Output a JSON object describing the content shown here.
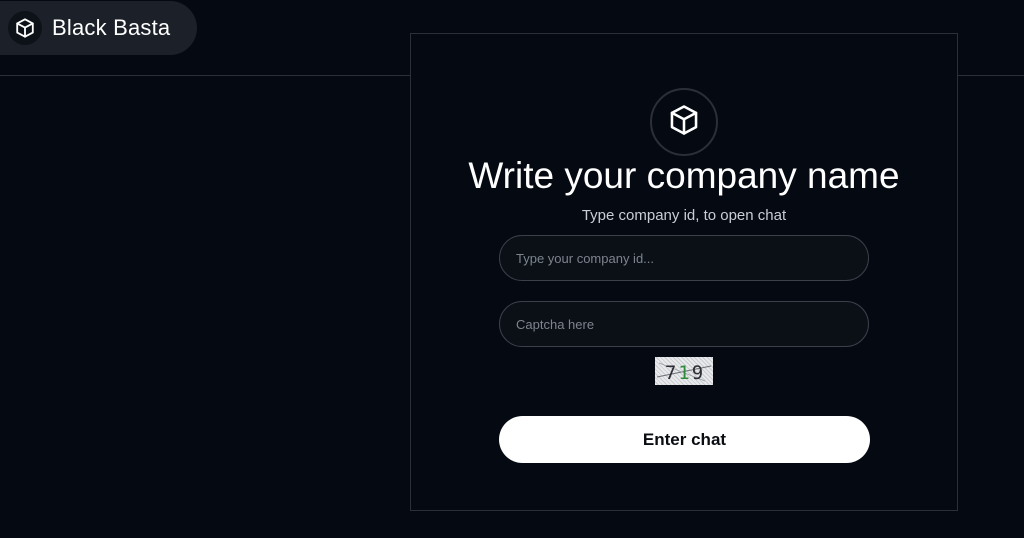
{
  "header": {
    "brand_name": "Black Basta",
    "brand_icon": "cube-icon"
  },
  "login": {
    "logo_icon": "cube-icon",
    "title": "Write your company name",
    "subtitle": "Type company id, to open chat",
    "company_input": {
      "value": "",
      "placeholder": "Type your company id..."
    },
    "captcha_input": {
      "value": "",
      "placeholder": "Captcha here"
    },
    "captcha_image_text": "719",
    "enter_button_label": "Enter chat"
  },
  "colors": {
    "background": "#050a12",
    "panel_border": "#2a3038",
    "brand_pill": "#1b2029",
    "button_bg": "#ffffff",
    "button_text": "#0a0d12"
  }
}
